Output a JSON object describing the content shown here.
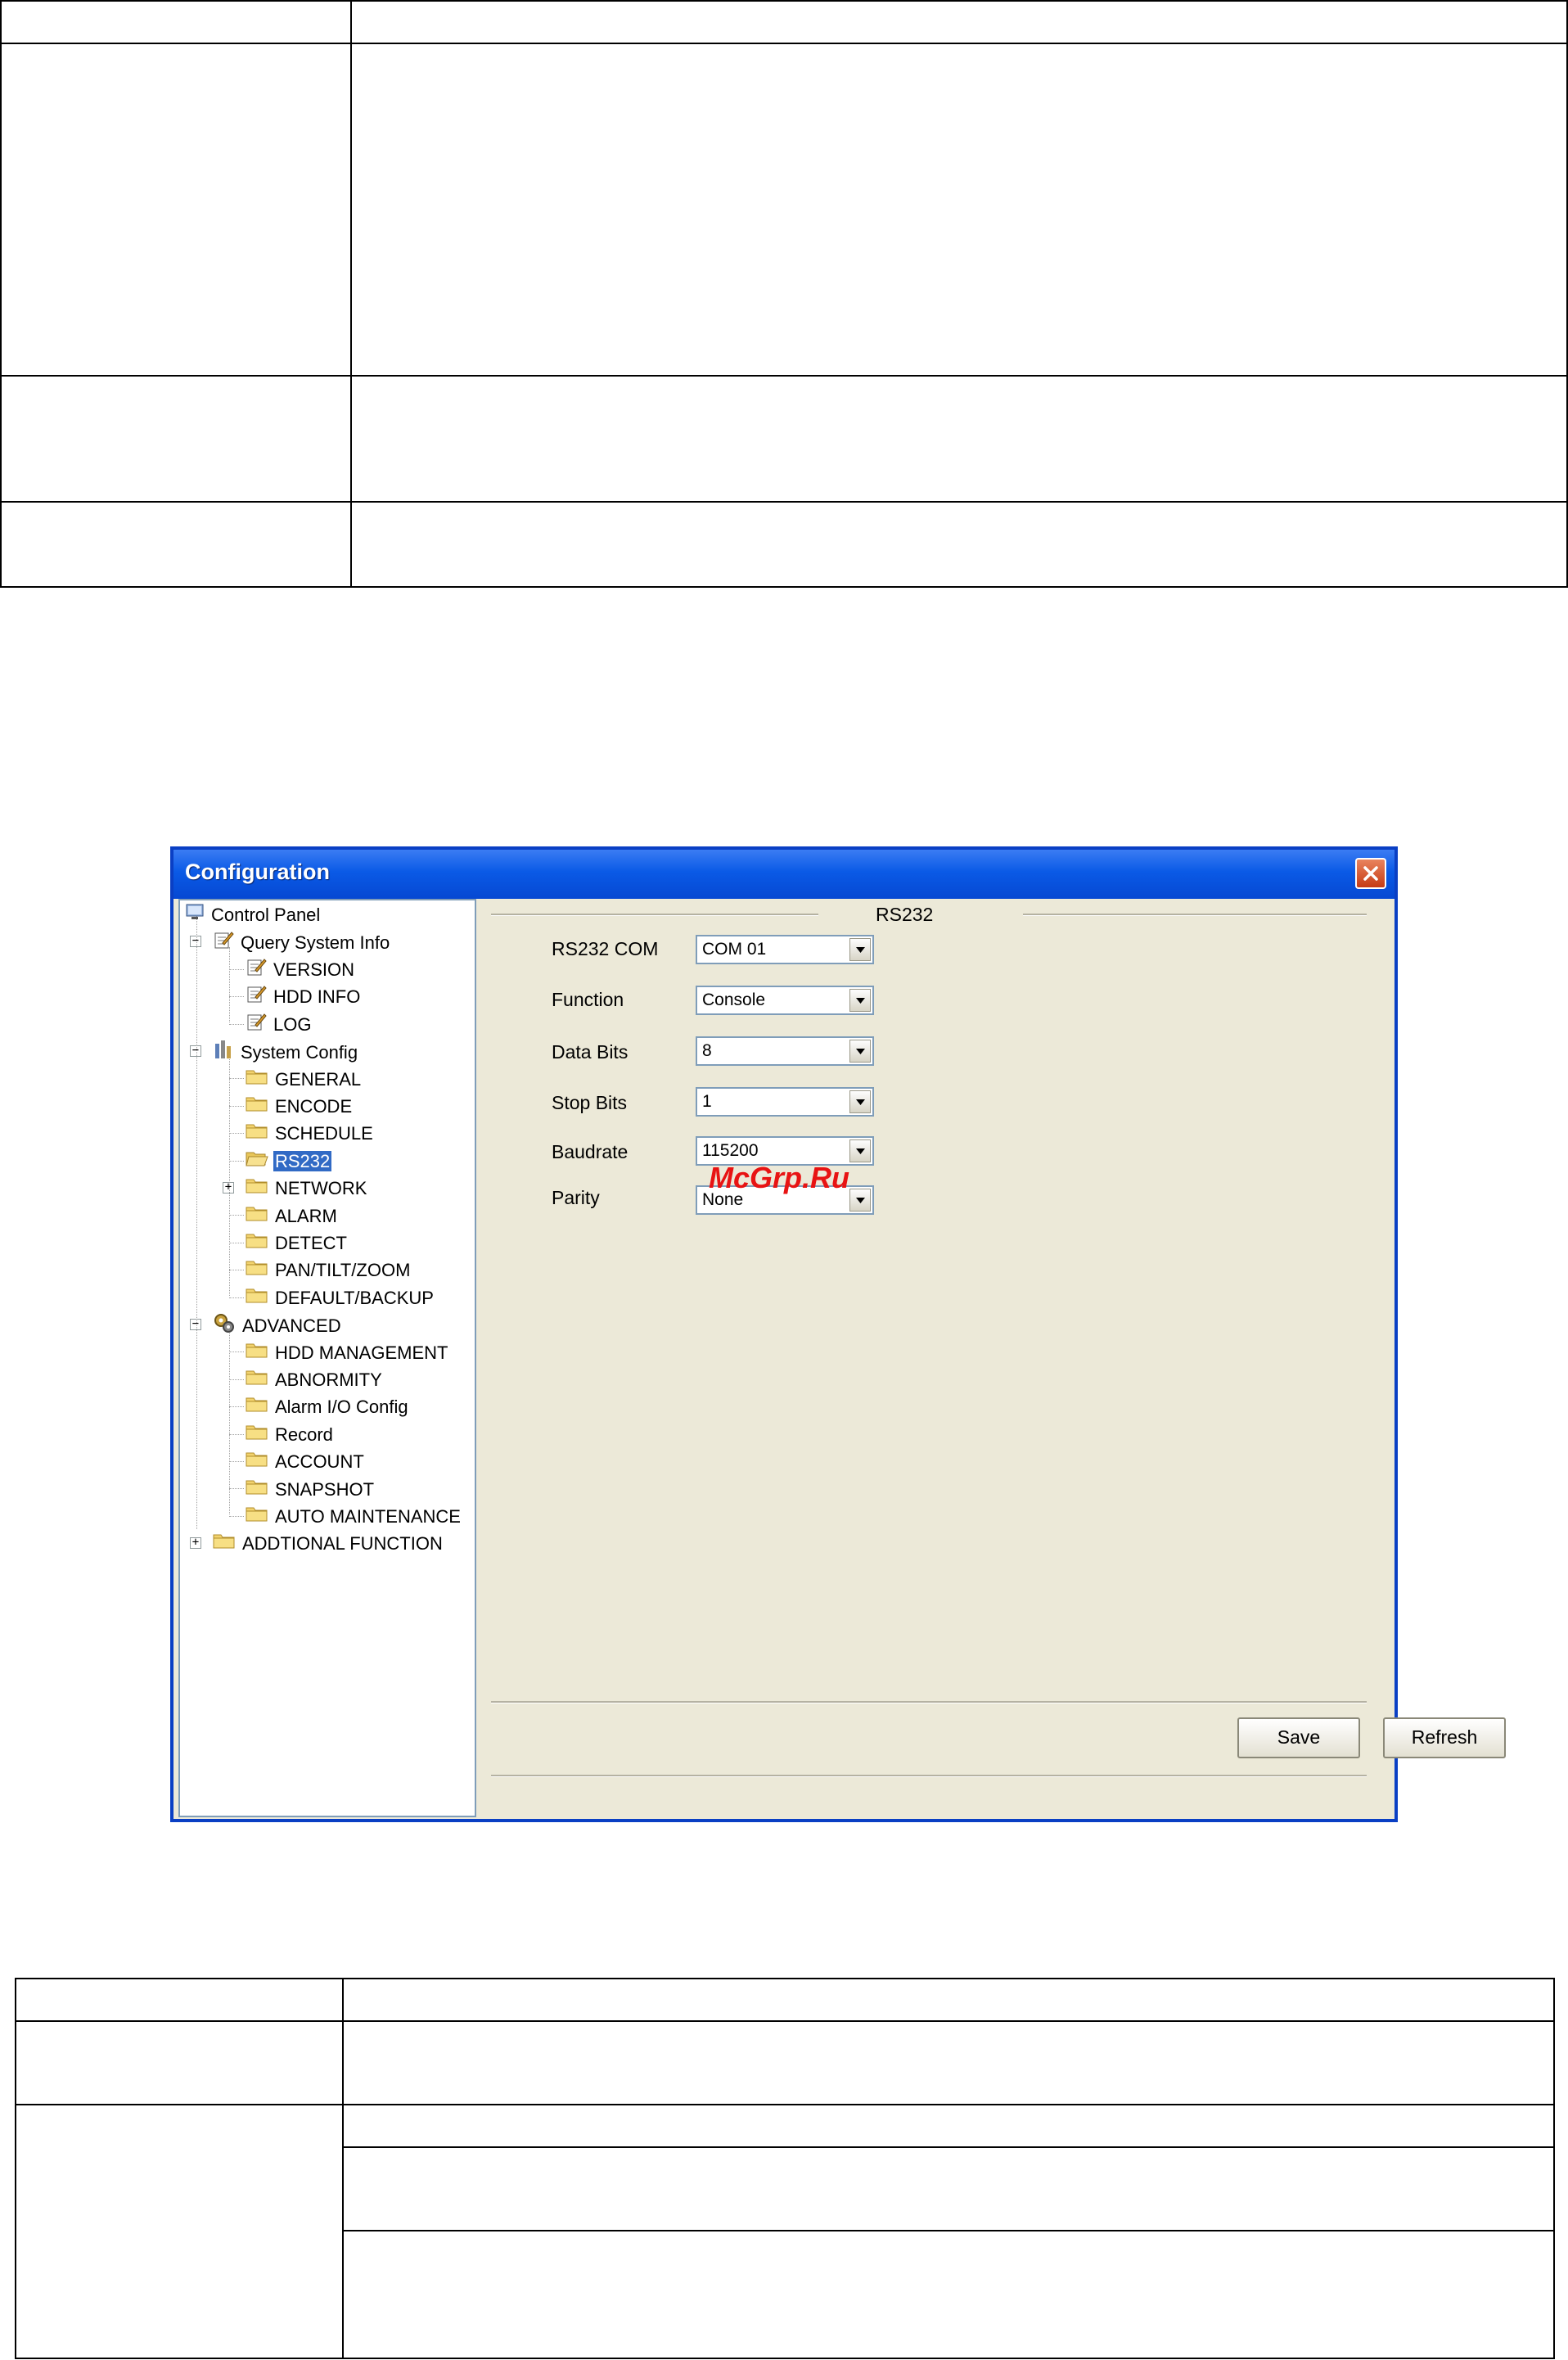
{
  "window": {
    "title": "Configuration"
  },
  "tree": {
    "items": [
      {
        "label": "Control Panel",
        "icon": "monitor-icon"
      },
      {
        "label": "Query System Info",
        "icon": "notepad-icon"
      },
      {
        "label": "VERSION",
        "icon": "notepad-icon"
      },
      {
        "label": "HDD INFO",
        "icon": "notepad-icon"
      },
      {
        "label": "LOG",
        "icon": "notepad-icon"
      },
      {
        "label": "System Config",
        "icon": "tools-icon"
      },
      {
        "label": "GENERAL",
        "icon": "folder-icon"
      },
      {
        "label": "ENCODE",
        "icon": "folder-icon"
      },
      {
        "label": "SCHEDULE",
        "icon": "folder-icon"
      },
      {
        "label": "RS232",
        "icon": "folder-open-icon",
        "selected": true
      },
      {
        "label": "NETWORK",
        "icon": "folder-icon"
      },
      {
        "label": "ALARM",
        "icon": "folder-icon"
      },
      {
        "label": "DETECT",
        "icon": "folder-icon"
      },
      {
        "label": "PAN/TILT/ZOOM",
        "icon": "folder-icon"
      },
      {
        "label": "DEFAULT/BACKUP",
        "icon": "folder-icon"
      },
      {
        "label": "ADVANCED",
        "icon": "gears-icon"
      },
      {
        "label": "HDD MANAGEMENT",
        "icon": "folder-icon"
      },
      {
        "label": "ABNORMITY",
        "icon": "folder-icon"
      },
      {
        "label": "Alarm I/O Config",
        "icon": "folder-icon"
      },
      {
        "label": "Record",
        "icon": "folder-icon"
      },
      {
        "label": "ACCOUNT",
        "icon": "folder-icon"
      },
      {
        "label": "SNAPSHOT",
        "icon": "folder-icon"
      },
      {
        "label": "AUTO MAINTENANCE",
        "icon": "folder-icon"
      },
      {
        "label": "ADDTIONAL FUNCTION",
        "icon": "folder-icon"
      }
    ]
  },
  "rs232": {
    "section_title": "RS232",
    "fields": [
      {
        "label": "RS232 COM",
        "value": "COM 01"
      },
      {
        "label": "Function",
        "value": "Console"
      },
      {
        "label": "Data Bits",
        "value": "8"
      },
      {
        "label": "Stop Bits",
        "value": "1"
      },
      {
        "label": "Baudrate",
        "value": "115200"
      },
      {
        "label": "Parity",
        "value": "None"
      }
    ],
    "save_label": "Save",
    "refresh_label": "Refresh"
  },
  "watermark": "McGrp.Ru",
  "colors": {
    "titlebar": "#0a5ae6",
    "window_bg": "#ece9d8",
    "selection": "#316ac5",
    "close_button": "#c63b14",
    "watermark": "#e81313"
  }
}
